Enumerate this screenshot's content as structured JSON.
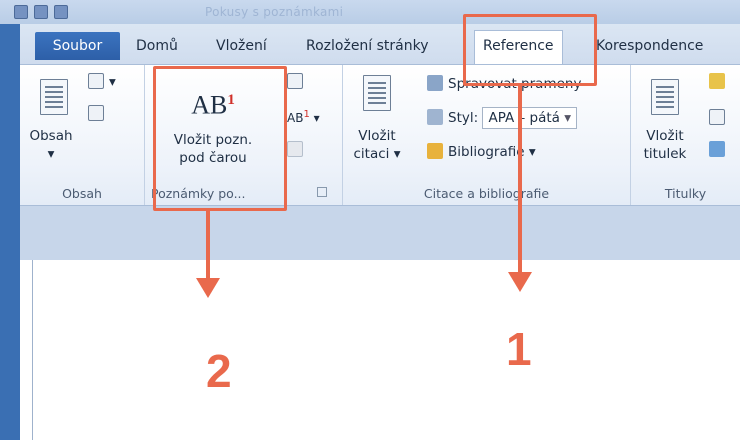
{
  "window": {
    "title": "Pokusy s poznámkami"
  },
  "tabs": {
    "file": "Soubor",
    "home": "Domů",
    "insert": "Vložení",
    "layout": "Rozložení stránky",
    "references": "Reference",
    "mailings": "Korespondence"
  },
  "groups": {
    "toc": {
      "button_line1": "Obsah",
      "button_arrow": "▾",
      "label": "Obsah"
    },
    "footnotes": {
      "icon_text": "AB",
      "icon_sup": "1",
      "button_line1": "Vložit pozn.",
      "button_line2": "pod čarou",
      "label": "Poznámky po...",
      "small_ab": "AB",
      "small_ab_sup": "1",
      "small_ab_arrow": "▾"
    },
    "citations": {
      "insert_line1": "Vložit",
      "insert_line2": "citaci ▾",
      "manage": "Spravovat prameny",
      "style_label": "Styl:",
      "style_value": "APA – pátá",
      "style_arrow": "▾",
      "bibliography": "Bibliografie ▾",
      "label": "Citace a bibliografie"
    },
    "captions": {
      "insert_line1": "Vložit",
      "insert_line2": "titulek",
      "label": "Titulky"
    }
  },
  "annotations": {
    "step1": "1",
    "step2": "2",
    "color": "#e9694c"
  }
}
